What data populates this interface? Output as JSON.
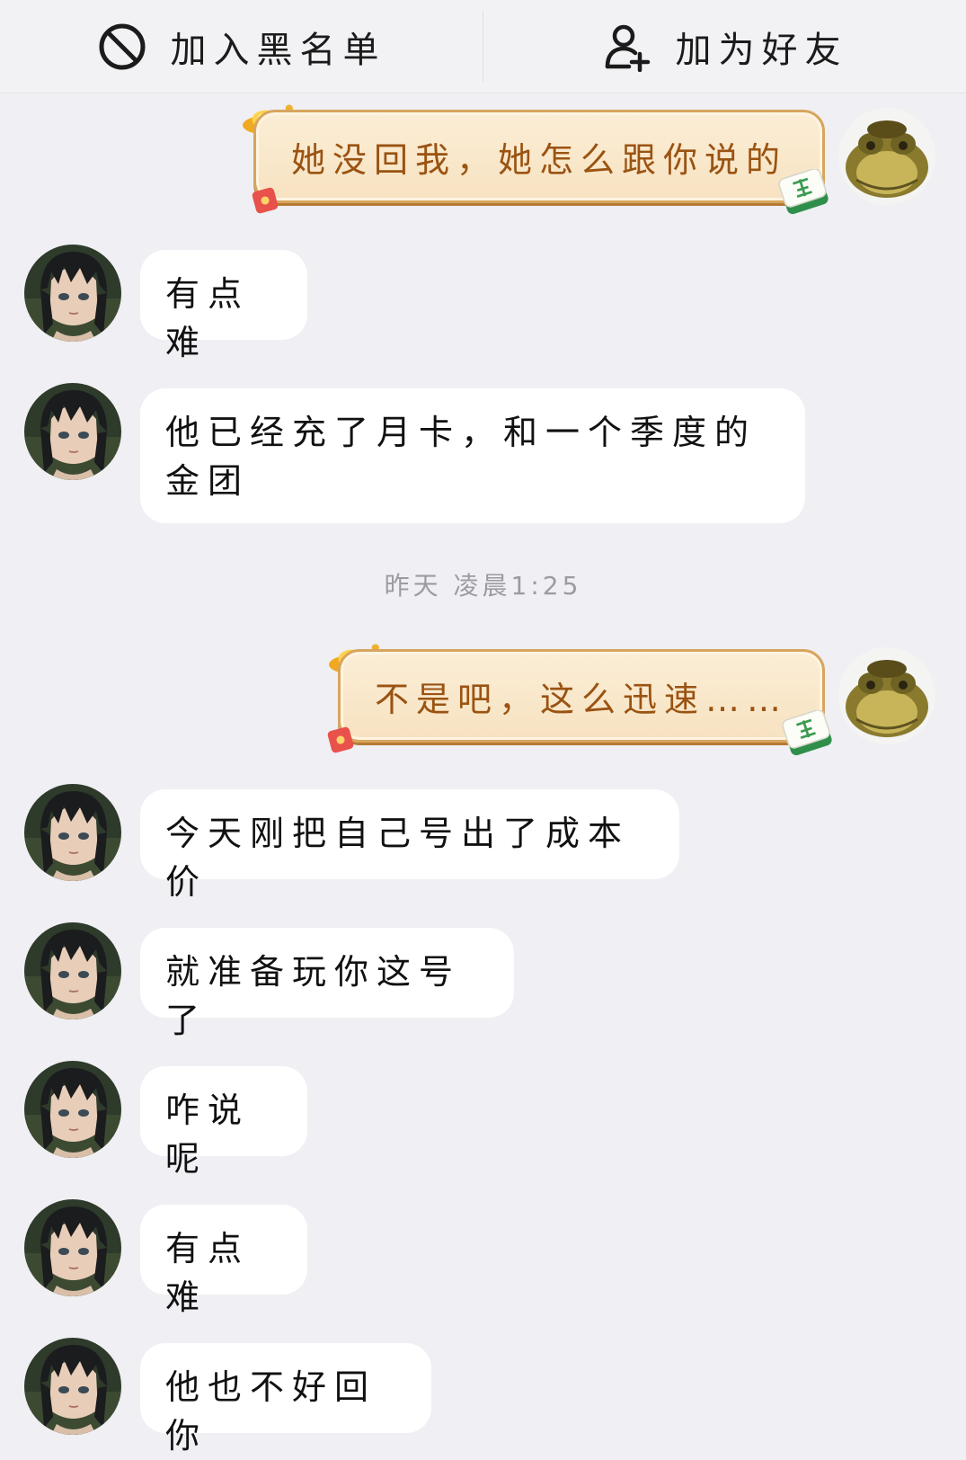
{
  "top_actions": {
    "block_label": "加入黑名单",
    "add_friend_label": "加为好友",
    "block_icon": "ban-icon",
    "add_friend_icon": "add-user-icon"
  },
  "timestamp": "昨天 凌晨1:25",
  "messages": [
    {
      "side": "right",
      "style": "golden",
      "text": "她没回我，她怎么跟你说的"
    },
    {
      "side": "left",
      "text": "有点难"
    },
    {
      "side": "left",
      "text": "他已经充了月卡，和一个季度的金团"
    },
    {
      "side": "right",
      "style": "golden",
      "text": "不是吧，这么迅速……"
    },
    {
      "side": "left",
      "text": "今天刚把自己号出了成本价"
    },
    {
      "side": "left",
      "text": "就准备玩你这号了"
    },
    {
      "side": "left",
      "text": "咋说呢"
    },
    {
      "side": "left",
      "text": "有点难"
    },
    {
      "side": "left",
      "text": "他也不好回你"
    }
  ],
  "colors": {
    "background": "#efeff4",
    "bubble": "#ffffff",
    "golden_text": "#9a5312",
    "golden_border": "#d8a55e",
    "timestamp": "#9b9ba2"
  }
}
